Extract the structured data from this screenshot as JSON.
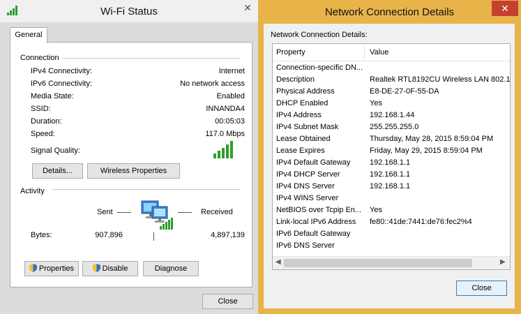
{
  "wifi": {
    "title": "Wi-Fi Status",
    "close_x": "✕",
    "tab": "General",
    "connection": {
      "title": "Connection",
      "rows": [
        {
          "label": "IPv4 Connectivity:",
          "value": "Internet"
        },
        {
          "label": "IPv6 Connectivity:",
          "value": "No network access"
        },
        {
          "label": "Media State:",
          "value": "Enabled"
        },
        {
          "label": "SSID:",
          "value": "INNANDA4"
        },
        {
          "label": "Duration:",
          "value": "00:05:03"
        },
        {
          "label": "Speed:",
          "value": "117.0 Mbps"
        }
      ],
      "signal_label": "Signal Quality:"
    },
    "buttons": {
      "details": "Details...",
      "wireless_properties": "Wireless Properties"
    },
    "activity": {
      "title": "Activity",
      "sent": "Sent",
      "received": "Received",
      "bytes_label": "Bytes:",
      "bytes_sent": "907,896",
      "bytes_received": "4,897,139"
    },
    "bottom_buttons": {
      "properties": "Properties",
      "disable": "Disable",
      "diagnose": "Diagnose"
    },
    "close": "Close"
  },
  "details": {
    "title": "Network Connection Details",
    "close_x": "✕",
    "label": "Network Connection Details:",
    "headers": {
      "property": "Property",
      "value": "Value"
    },
    "rows": [
      {
        "property": "Connection-specific DN...",
        "value": ""
      },
      {
        "property": "Description",
        "value": "Realtek RTL8192CU Wireless LAN 802.1"
      },
      {
        "property": "Physical Address",
        "value": "E8-DE-27-0F-55-DA"
      },
      {
        "property": "DHCP Enabled",
        "value": "Yes"
      },
      {
        "property": "IPv4 Address",
        "value": "192.168.1.44"
      },
      {
        "property": "IPv4 Subnet Mask",
        "value": "255.255.255.0"
      },
      {
        "property": "Lease Obtained",
        "value": "Thursday, May 28, 2015 8:59:04 PM"
      },
      {
        "property": "Lease Expires",
        "value": "Friday, May 29, 2015 8:59:04 PM"
      },
      {
        "property": "IPv4 Default Gateway",
        "value": "192.168.1.1"
      },
      {
        "property": "IPv4 DHCP Server",
        "value": "192.168.1.1"
      },
      {
        "property": "IPv4 DNS Server",
        "value": "192.168.1.1"
      },
      {
        "property": "IPv4 WINS Server",
        "value": ""
      },
      {
        "property": "NetBIOS over Tcpip En...",
        "value": "Yes"
      },
      {
        "property": "Link-local IPv6 Address",
        "value": "fe80::41de:7441:de76:fec2%4"
      },
      {
        "property": "IPv6 Default Gateway",
        "value": ""
      },
      {
        "property": "IPv6 DNS Server",
        "value": ""
      }
    ],
    "close": "Close"
  },
  "colors": {
    "window_frame": "#e8b44a",
    "close_red": "#c7402f",
    "signal_green": "#2e9d2e"
  }
}
